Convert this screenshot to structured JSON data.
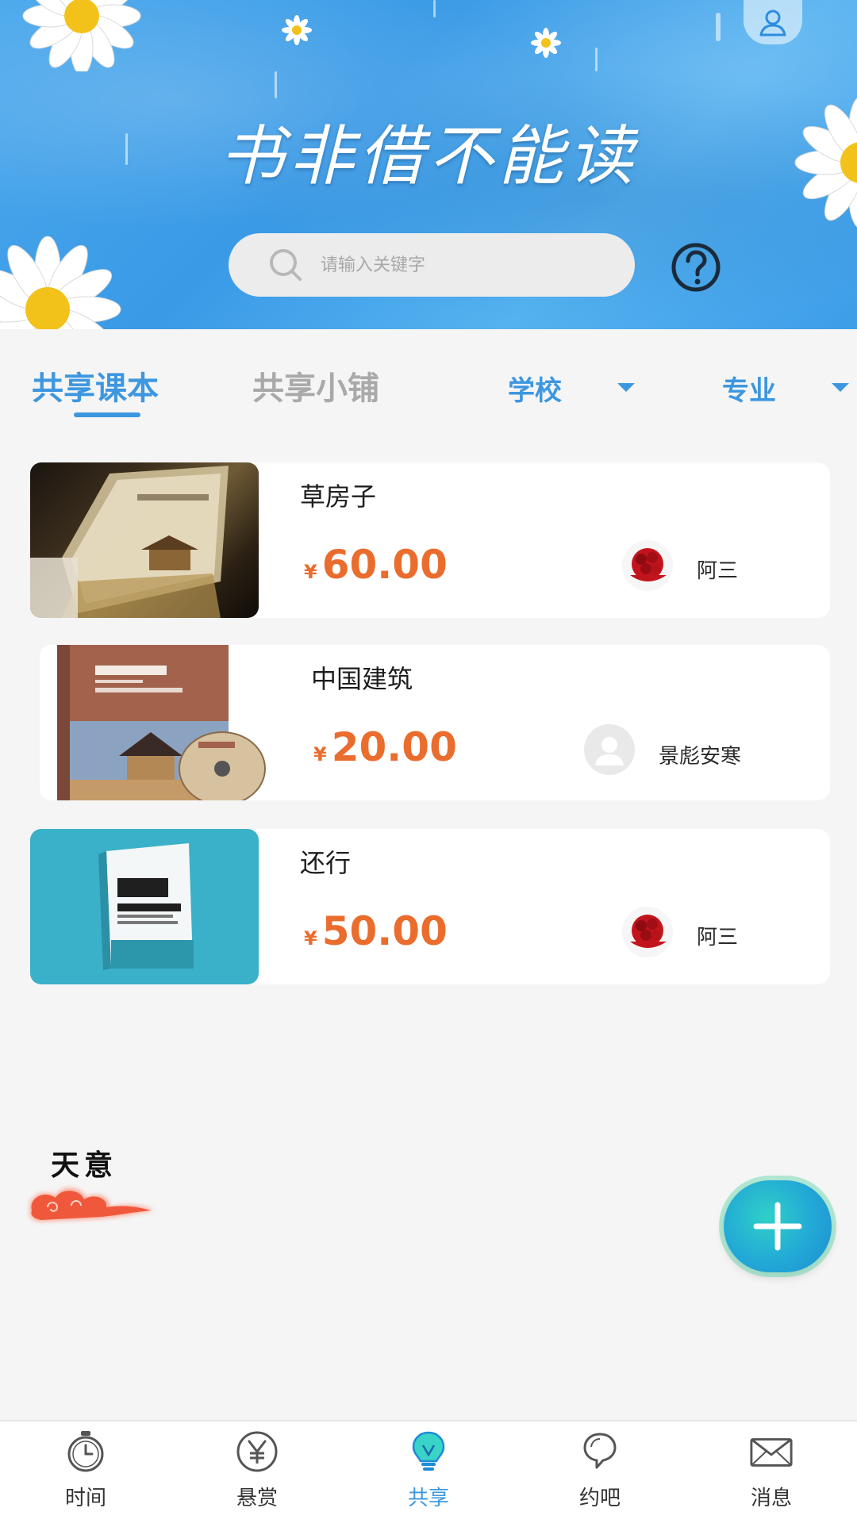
{
  "header": {
    "title": "书非借不能读",
    "search": {
      "placeholder": "请输入关键字",
      "value": ""
    },
    "icons": {
      "user": "user-icon",
      "help": "question-icon",
      "search": "search-icon"
    }
  },
  "tabs": [
    {
      "label": "共享课本",
      "active": true
    },
    {
      "label": "共享小铺",
      "active": false
    }
  ],
  "filters": [
    {
      "label": "学校"
    },
    {
      "label": "专业"
    }
  ],
  "books": [
    {
      "title": "草房子",
      "currency": "¥",
      "price": "60.00",
      "seller": "阿三",
      "avatar": "rose-avatar"
    },
    {
      "title": "中国建筑",
      "currency": "¥",
      "price": "20.00",
      "seller": "景彪安寒",
      "avatar": "default-avatar"
    },
    {
      "title": "还行",
      "currency": "¥",
      "price": "50.00",
      "seller": "阿三",
      "avatar": "rose-avatar"
    }
  ],
  "watermark": {
    "text": "天意"
  },
  "fab": {
    "icon": "plus-icon"
  },
  "nav": [
    {
      "label": "时间",
      "icon": "clock-icon",
      "active": false
    },
    {
      "label": "悬赏",
      "icon": "yen-icon",
      "active": false
    },
    {
      "label": "共享",
      "icon": "lightbulb-icon",
      "active": true
    },
    {
      "label": "约吧",
      "icon": "chat-bubble-icon",
      "active": false
    },
    {
      "label": "消息",
      "icon": "envelope-icon",
      "active": false
    }
  ],
  "colors": {
    "accent": "#3d97e0",
    "price": "#ea6d2e",
    "banner": "#4aa8ec",
    "fab": "#22a8d6"
  }
}
